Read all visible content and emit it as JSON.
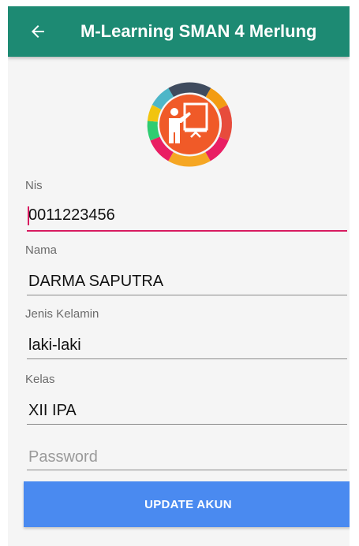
{
  "appbar": {
    "title": "M-Learning SMAN 4 Merlung",
    "back_icon": "arrow-left-icon",
    "color": "#1d8a73"
  },
  "logo": {
    "icon": "teacher-presentation-icon"
  },
  "form": {
    "nis": {
      "label": "Nis",
      "value": "0011223456"
    },
    "nama": {
      "label": "Nama",
      "value": "DARMA SAPUTRA"
    },
    "jenis_kelamin": {
      "label": "Jenis Kelamin",
      "value": "laki-laki"
    },
    "kelas": {
      "label": "Kelas",
      "value": "XII IPA"
    },
    "password": {
      "placeholder": "Password",
      "value": ""
    }
  },
  "update_button": {
    "label": "UPDATE AKUN",
    "color": "#4a8af0"
  },
  "colors": {
    "accent": "#d81b60",
    "background": "#f5f5f5"
  }
}
